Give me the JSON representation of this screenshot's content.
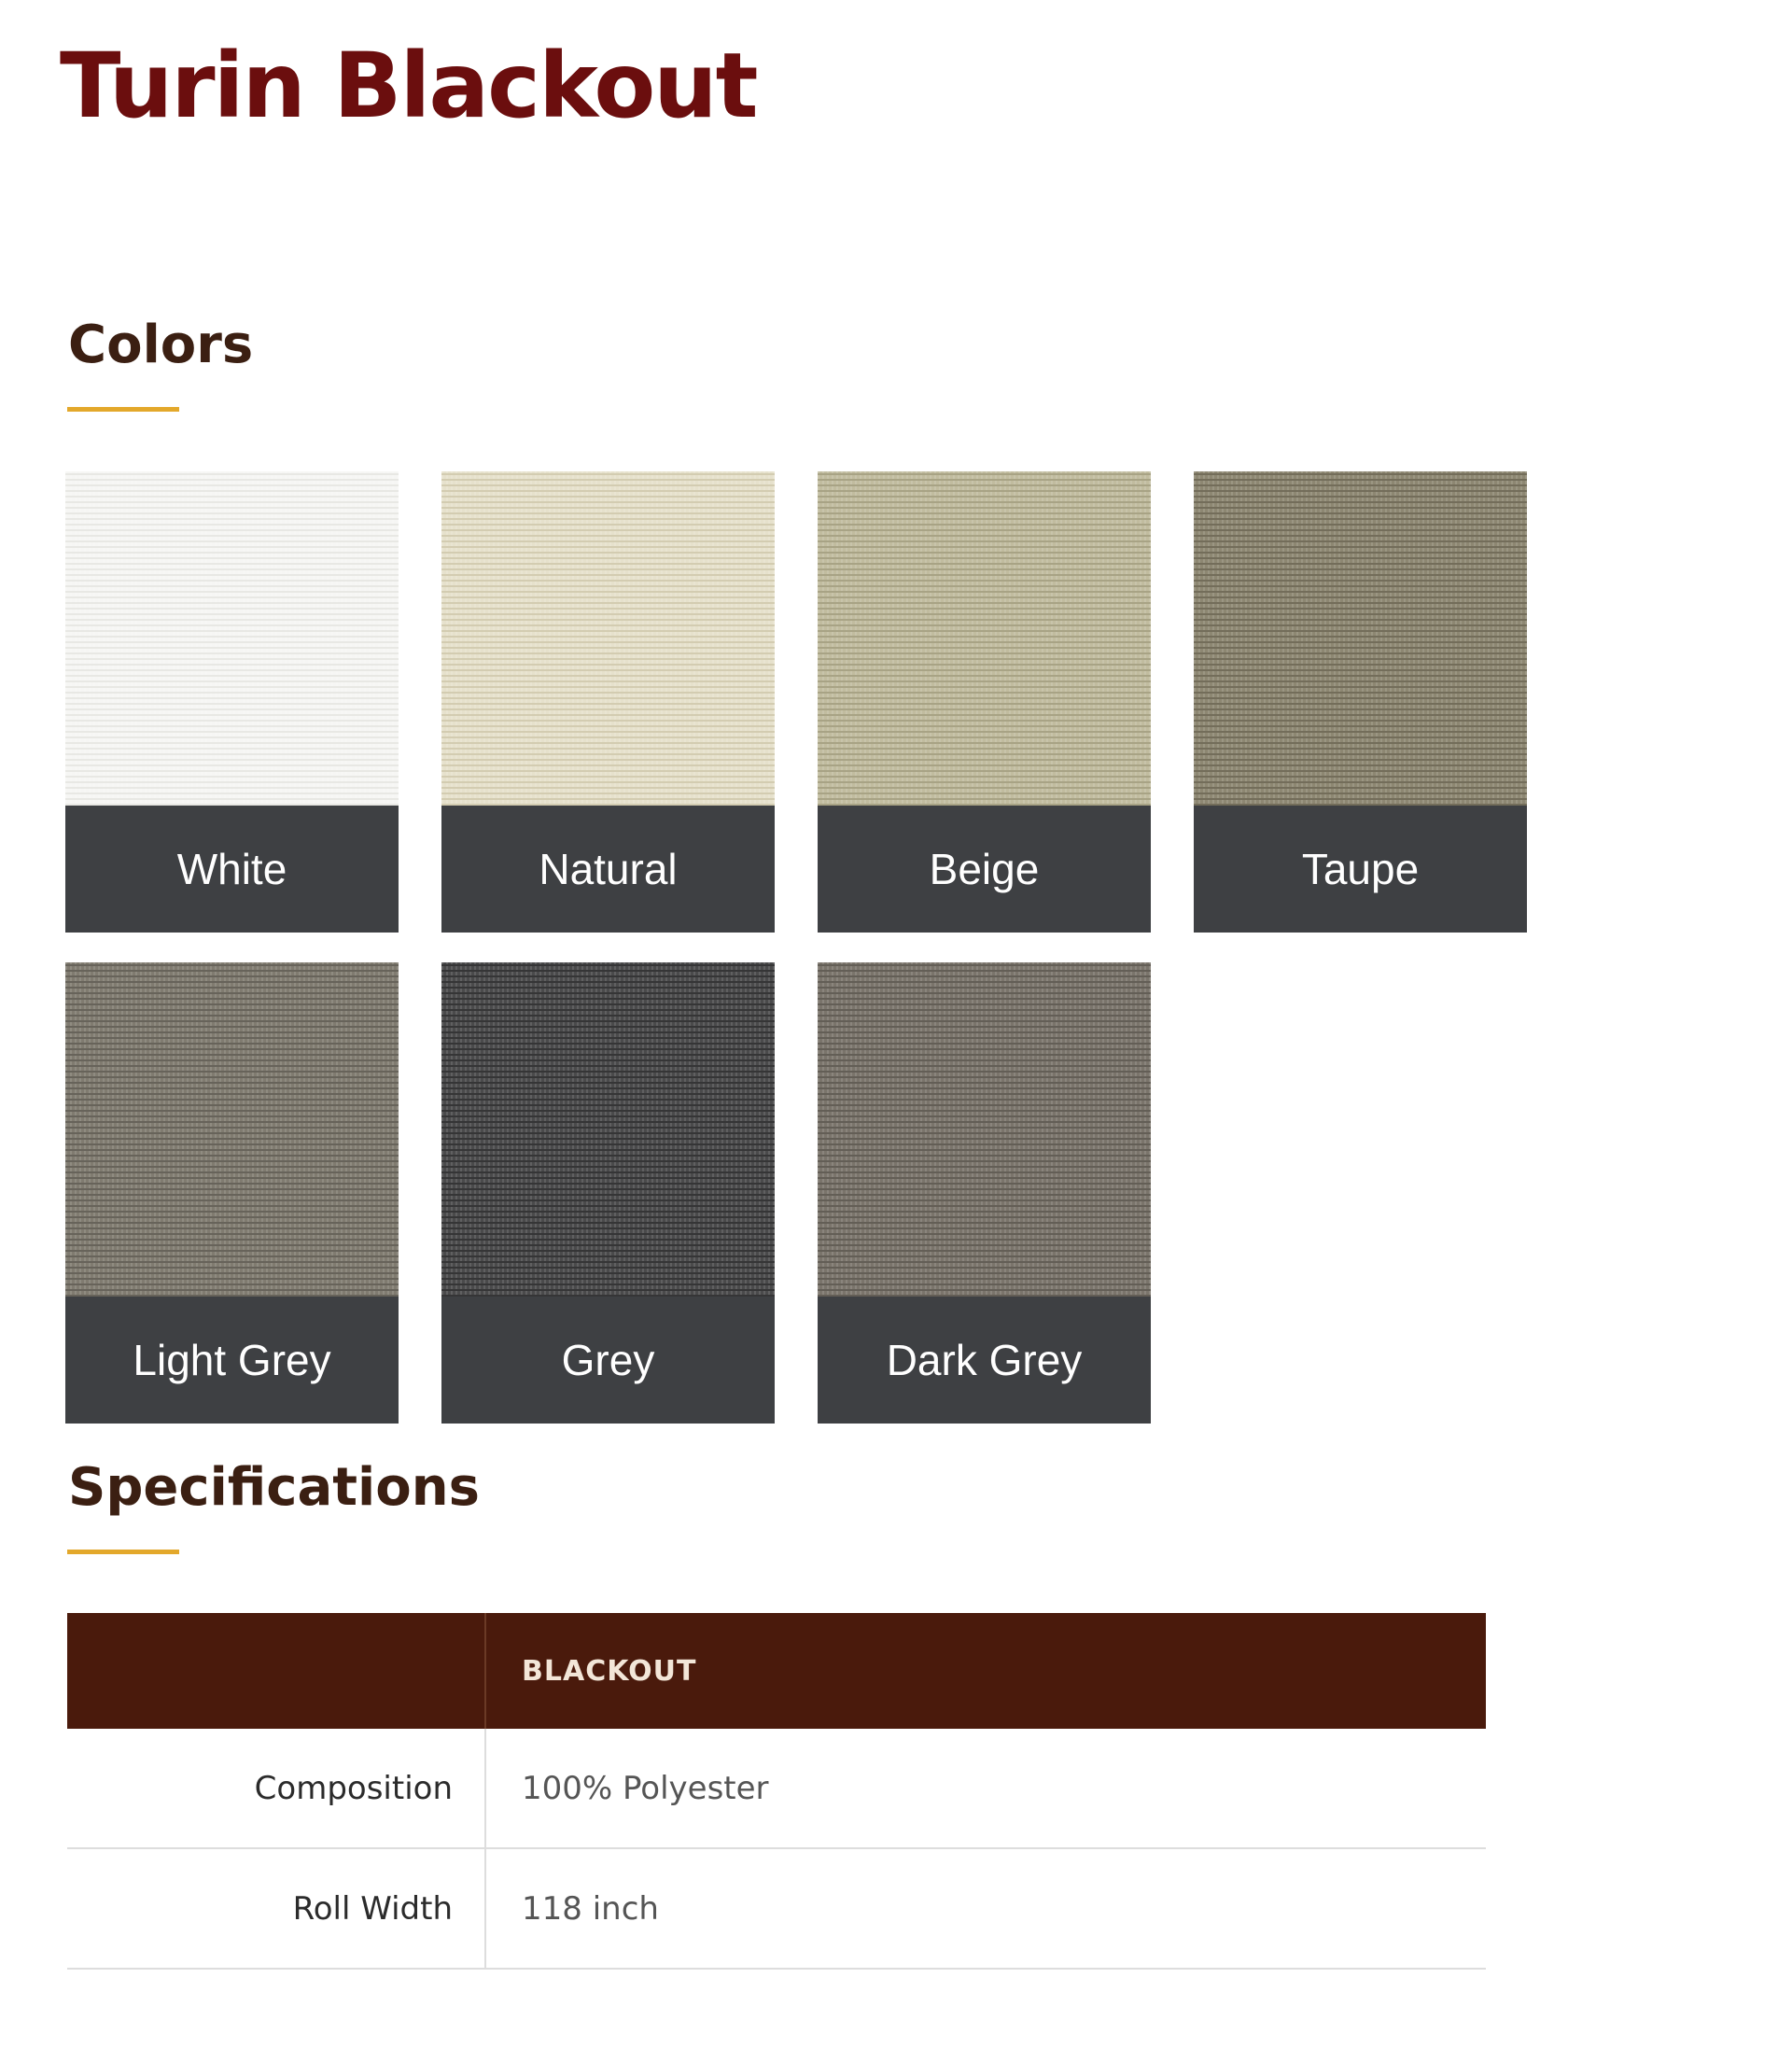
{
  "page": {
    "title": "Turin Blackout"
  },
  "colors_section": {
    "heading": "Colors",
    "swatches": [
      {
        "label": "White",
        "fabric_color": "#f6f6f4",
        "weave_color": "#e8e8e4"
      },
      {
        "label": "Natural",
        "fabric_color": "#e6e1cc",
        "weave_color": "#d3ccb1"
      },
      {
        "label": "Beige",
        "fabric_color": "#c1bc9f",
        "weave_color": "#a8a385"
      },
      {
        "label": "Taupe",
        "fabric_color": "#8d8772",
        "weave_color": "#736d5a"
      },
      {
        "label": "Light Grey",
        "fabric_color": "#807b70",
        "weave_color": "#67635a"
      },
      {
        "label": "Grey",
        "fabric_color": "#4a4a4b",
        "weave_color": "#353536"
      },
      {
        "label": "Dark Grey",
        "fabric_color": "#7a746b",
        "weave_color": "#635e56"
      }
    ]
  },
  "specifications_section": {
    "heading": "Specifications",
    "table": {
      "header": [
        "",
        "BLACKOUT"
      ],
      "rows": [
        {
          "label": "Composition",
          "value": "100% Polyester"
        },
        {
          "label": "Roll Width",
          "value": "118 inch"
        }
      ]
    }
  },
  "colors": {
    "title": "#6b0e0e",
    "accent_underline": "#e3a82b",
    "label_bar": "#3e4043",
    "table_header_bg": "#4a1a0c",
    "table_header_text": "#f3e6d8"
  }
}
